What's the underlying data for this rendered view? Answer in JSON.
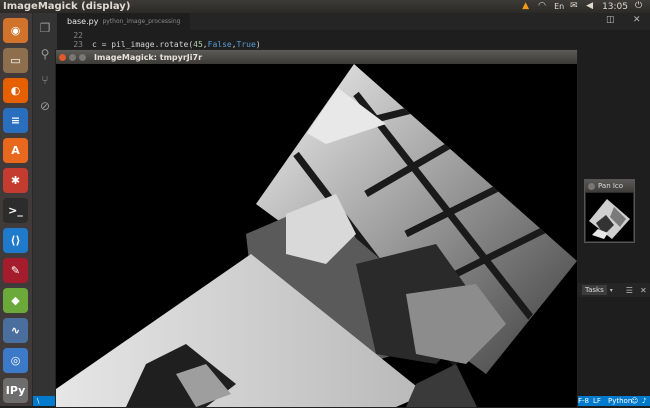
{
  "topbar": {
    "title": "ImageMagick (display)",
    "time": "13:05",
    "icons": [
      "vlc-icon",
      "wifi-icon",
      "keyboard-icon",
      "mail-icon",
      "volume-icon",
      "power-icon"
    ]
  },
  "launcher": {
    "items": [
      {
        "name": "ubuntu-dash-icon",
        "glyph": "◉",
        "color": "#d1732a"
      },
      {
        "name": "files-icon",
        "glyph": "▭",
        "color": "#8d6f4e"
      },
      {
        "name": "firefox-icon",
        "glyph": "◐",
        "color": "#e66000"
      },
      {
        "name": "writer-icon",
        "glyph": "≡",
        "color": "#2a6fbe"
      },
      {
        "name": "software-center-icon",
        "glyph": "A",
        "color": "#e8691e"
      },
      {
        "name": "system-settings-icon",
        "glyph": "✱",
        "color": "#c43b2f"
      },
      {
        "name": "terminal-icon",
        "glyph": ">_",
        "color": "#2c2c2c"
      },
      {
        "name": "vscode-icon",
        "glyph": "⟨⟩",
        "color": "#1f7acc"
      },
      {
        "name": "wine-icon",
        "glyph": "✎",
        "color": "#a51d2d"
      },
      {
        "name": "package-icon",
        "glyph": "◆",
        "color": "#6aa93a"
      },
      {
        "name": "monitor-icon",
        "glyph": "∿",
        "color": "#4a6f9e"
      },
      {
        "name": "chrome-icon",
        "glyph": "◎",
        "color": "#3d79c9"
      },
      {
        "name": "ipython-icon",
        "glyph": "IPy",
        "color": "#6d6d6d"
      }
    ]
  },
  "vscode": {
    "tab": {
      "filename": "base.py",
      "path": "python_image_processing"
    },
    "lines": [
      {
        "num": "22",
        "code": ""
      },
      {
        "num": "23",
        "code": "c = pil_image.rotate(45,False,True)"
      }
    ],
    "panel": {
      "tasks_label": "Tasks"
    },
    "status": {
      "left": "\\",
      "encoding": "F-8",
      "eol": "LF",
      "language": "Python"
    }
  },
  "pan_icon": {
    "title": "Pan Ico"
  },
  "imagemagick": {
    "title": "ImageMagick: tmpyrJi7r"
  },
  "colors": {
    "vscode_blue": "#007acc",
    "editor_bg": "#1e1e1e",
    "launcher_bg": "#403b3a"
  }
}
